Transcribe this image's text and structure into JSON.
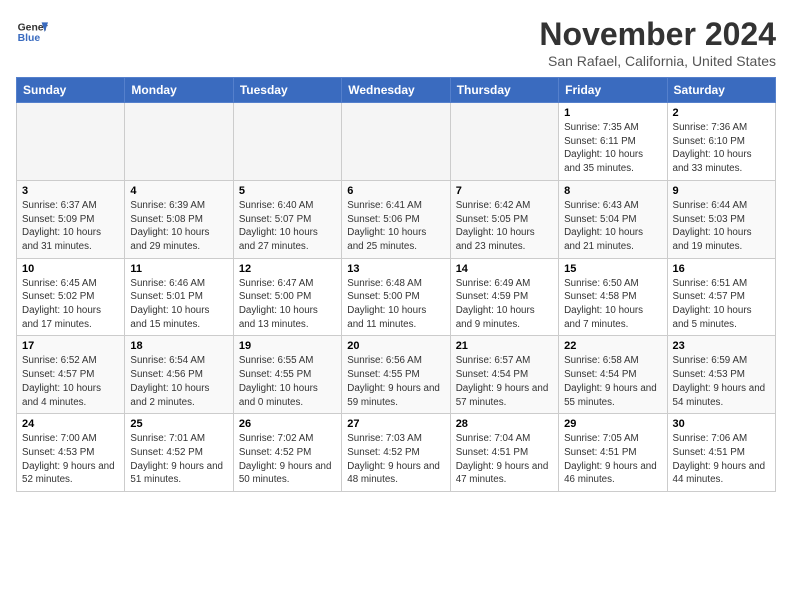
{
  "header": {
    "logo_line1": "General",
    "logo_line2": "Blue",
    "month_title": "November 2024",
    "location": "San Rafael, California, United States"
  },
  "weekdays": [
    "Sunday",
    "Monday",
    "Tuesday",
    "Wednesday",
    "Thursday",
    "Friday",
    "Saturday"
  ],
  "weeks": [
    {
      "days": [
        {
          "num": "",
          "info": ""
        },
        {
          "num": "",
          "info": ""
        },
        {
          "num": "",
          "info": ""
        },
        {
          "num": "",
          "info": ""
        },
        {
          "num": "",
          "info": ""
        },
        {
          "num": "1",
          "info": "Sunrise: 7:35 AM\nSunset: 6:11 PM\nDaylight: 10 hours\nand 35 minutes."
        },
        {
          "num": "2",
          "info": "Sunrise: 7:36 AM\nSunset: 6:10 PM\nDaylight: 10 hours\nand 33 minutes."
        }
      ]
    },
    {
      "days": [
        {
          "num": "3",
          "info": "Sunrise: 6:37 AM\nSunset: 5:09 PM\nDaylight: 10 hours\nand 31 minutes."
        },
        {
          "num": "4",
          "info": "Sunrise: 6:39 AM\nSunset: 5:08 PM\nDaylight: 10 hours\nand 29 minutes."
        },
        {
          "num": "5",
          "info": "Sunrise: 6:40 AM\nSunset: 5:07 PM\nDaylight: 10 hours\nand 27 minutes."
        },
        {
          "num": "6",
          "info": "Sunrise: 6:41 AM\nSunset: 5:06 PM\nDaylight: 10 hours\nand 25 minutes."
        },
        {
          "num": "7",
          "info": "Sunrise: 6:42 AM\nSunset: 5:05 PM\nDaylight: 10 hours\nand 23 minutes."
        },
        {
          "num": "8",
          "info": "Sunrise: 6:43 AM\nSunset: 5:04 PM\nDaylight: 10 hours\nand 21 minutes."
        },
        {
          "num": "9",
          "info": "Sunrise: 6:44 AM\nSunset: 5:03 PM\nDaylight: 10 hours\nand 19 minutes."
        }
      ]
    },
    {
      "days": [
        {
          "num": "10",
          "info": "Sunrise: 6:45 AM\nSunset: 5:02 PM\nDaylight: 10 hours\nand 17 minutes."
        },
        {
          "num": "11",
          "info": "Sunrise: 6:46 AM\nSunset: 5:01 PM\nDaylight: 10 hours\nand 15 minutes."
        },
        {
          "num": "12",
          "info": "Sunrise: 6:47 AM\nSunset: 5:00 PM\nDaylight: 10 hours\nand 13 minutes."
        },
        {
          "num": "13",
          "info": "Sunrise: 6:48 AM\nSunset: 5:00 PM\nDaylight: 10 hours\nand 11 minutes."
        },
        {
          "num": "14",
          "info": "Sunrise: 6:49 AM\nSunset: 4:59 PM\nDaylight: 10 hours\nand 9 minutes."
        },
        {
          "num": "15",
          "info": "Sunrise: 6:50 AM\nSunset: 4:58 PM\nDaylight: 10 hours\nand 7 minutes."
        },
        {
          "num": "16",
          "info": "Sunrise: 6:51 AM\nSunset: 4:57 PM\nDaylight: 10 hours\nand 5 minutes."
        }
      ]
    },
    {
      "days": [
        {
          "num": "17",
          "info": "Sunrise: 6:52 AM\nSunset: 4:57 PM\nDaylight: 10 hours\nand 4 minutes."
        },
        {
          "num": "18",
          "info": "Sunrise: 6:54 AM\nSunset: 4:56 PM\nDaylight: 10 hours\nand 2 minutes."
        },
        {
          "num": "19",
          "info": "Sunrise: 6:55 AM\nSunset: 4:55 PM\nDaylight: 10 hours\nand 0 minutes."
        },
        {
          "num": "20",
          "info": "Sunrise: 6:56 AM\nSunset: 4:55 PM\nDaylight: 9 hours\nand 59 minutes."
        },
        {
          "num": "21",
          "info": "Sunrise: 6:57 AM\nSunset: 4:54 PM\nDaylight: 9 hours\nand 57 minutes."
        },
        {
          "num": "22",
          "info": "Sunrise: 6:58 AM\nSunset: 4:54 PM\nDaylight: 9 hours\nand 55 minutes."
        },
        {
          "num": "23",
          "info": "Sunrise: 6:59 AM\nSunset: 4:53 PM\nDaylight: 9 hours\nand 54 minutes."
        }
      ]
    },
    {
      "days": [
        {
          "num": "24",
          "info": "Sunrise: 7:00 AM\nSunset: 4:53 PM\nDaylight: 9 hours\nand 52 minutes."
        },
        {
          "num": "25",
          "info": "Sunrise: 7:01 AM\nSunset: 4:52 PM\nDaylight: 9 hours\nand 51 minutes."
        },
        {
          "num": "26",
          "info": "Sunrise: 7:02 AM\nSunset: 4:52 PM\nDaylight: 9 hours\nand 50 minutes."
        },
        {
          "num": "27",
          "info": "Sunrise: 7:03 AM\nSunset: 4:52 PM\nDaylight: 9 hours\nand 48 minutes."
        },
        {
          "num": "28",
          "info": "Sunrise: 7:04 AM\nSunset: 4:51 PM\nDaylight: 9 hours\nand 47 minutes."
        },
        {
          "num": "29",
          "info": "Sunrise: 7:05 AM\nSunset: 4:51 PM\nDaylight: 9 hours\nand 46 minutes."
        },
        {
          "num": "30",
          "info": "Sunrise: 7:06 AM\nSunset: 4:51 PM\nDaylight: 9 hours\nand 44 minutes."
        }
      ]
    }
  ]
}
